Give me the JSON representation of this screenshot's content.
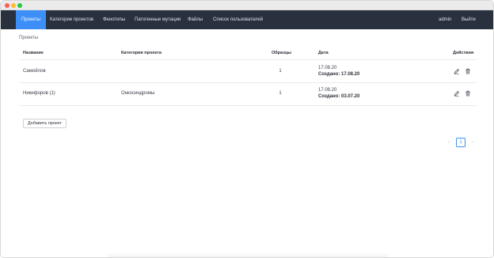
{
  "window": {
    "traffic_lights": [
      "close",
      "minimize",
      "maximize"
    ]
  },
  "navbar": {
    "items": [
      {
        "label": "Проекты",
        "active": true
      },
      {
        "label": "Категории проектов",
        "active": false
      },
      {
        "label": "Фенотипы",
        "active": false
      },
      {
        "label": "Патогенные мутации",
        "active": false
      },
      {
        "label": "Файлы",
        "active": false
      },
      {
        "label": "Список пользователей",
        "active": false
      }
    ],
    "user": "admin",
    "logout": "Выйти",
    "colors": {
      "background": "#2a313e",
      "active": "#3d8ff7"
    }
  },
  "breadcrumb": "Проекты",
  "table": {
    "headers": {
      "name": "Название",
      "category": "Категория проекта",
      "samples": "Образцы",
      "date": "Дата",
      "actions": "Действия"
    },
    "rows": [
      {
        "name": "Самойлов",
        "category": "",
        "samples": "1",
        "date": "17.08.20",
        "created": "Создано: 17.08.20",
        "actions": [
          "edit-icon",
          "trash-icon"
        ]
      },
      {
        "name": "Никифоров (1)",
        "category": "Онкосиндромы",
        "samples": "1",
        "date": "17.08.20",
        "created": "Создано: 03.07.20",
        "actions": [
          "edit-icon",
          "trash-icon"
        ]
      }
    ]
  },
  "add_project_button": "Добавить проект",
  "pagination": {
    "prev": "‹",
    "current_page": "1",
    "next": "›"
  }
}
